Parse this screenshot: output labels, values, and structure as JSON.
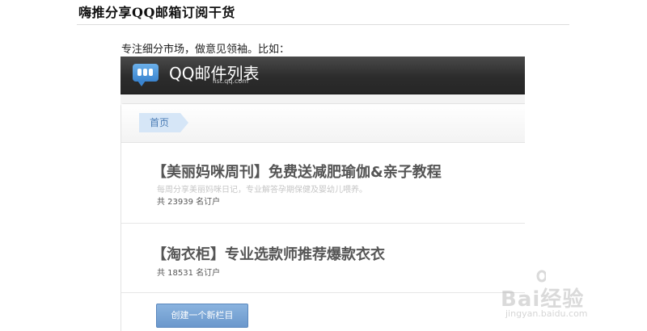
{
  "page": {
    "title": "嗨推分享QQ邮箱订阅干货",
    "intro": "专注细分市场，做意见领袖。比如："
  },
  "app": {
    "name": "QQ邮件列表",
    "domain": "list.qq.com"
  },
  "breadcrumb": {
    "home": "首页"
  },
  "lists": [
    {
      "title": "【美丽妈咪周刊】免费送减肥瑜伽&亲子教程",
      "description": "每周分享美丽妈咪日记，专业解答孕期保健及婴幼儿喂养。",
      "subscribers": "共 23939 名订户"
    },
    {
      "title": "【淘衣柜】专业选款师推荐爆款衣衣",
      "subscribers": "共 18531 名订户"
    }
  ],
  "actions": {
    "create": "创建一个新栏目"
  },
  "watermark": {
    "brand": "Bai经验",
    "url": "jingyan.baidu.com"
  }
}
